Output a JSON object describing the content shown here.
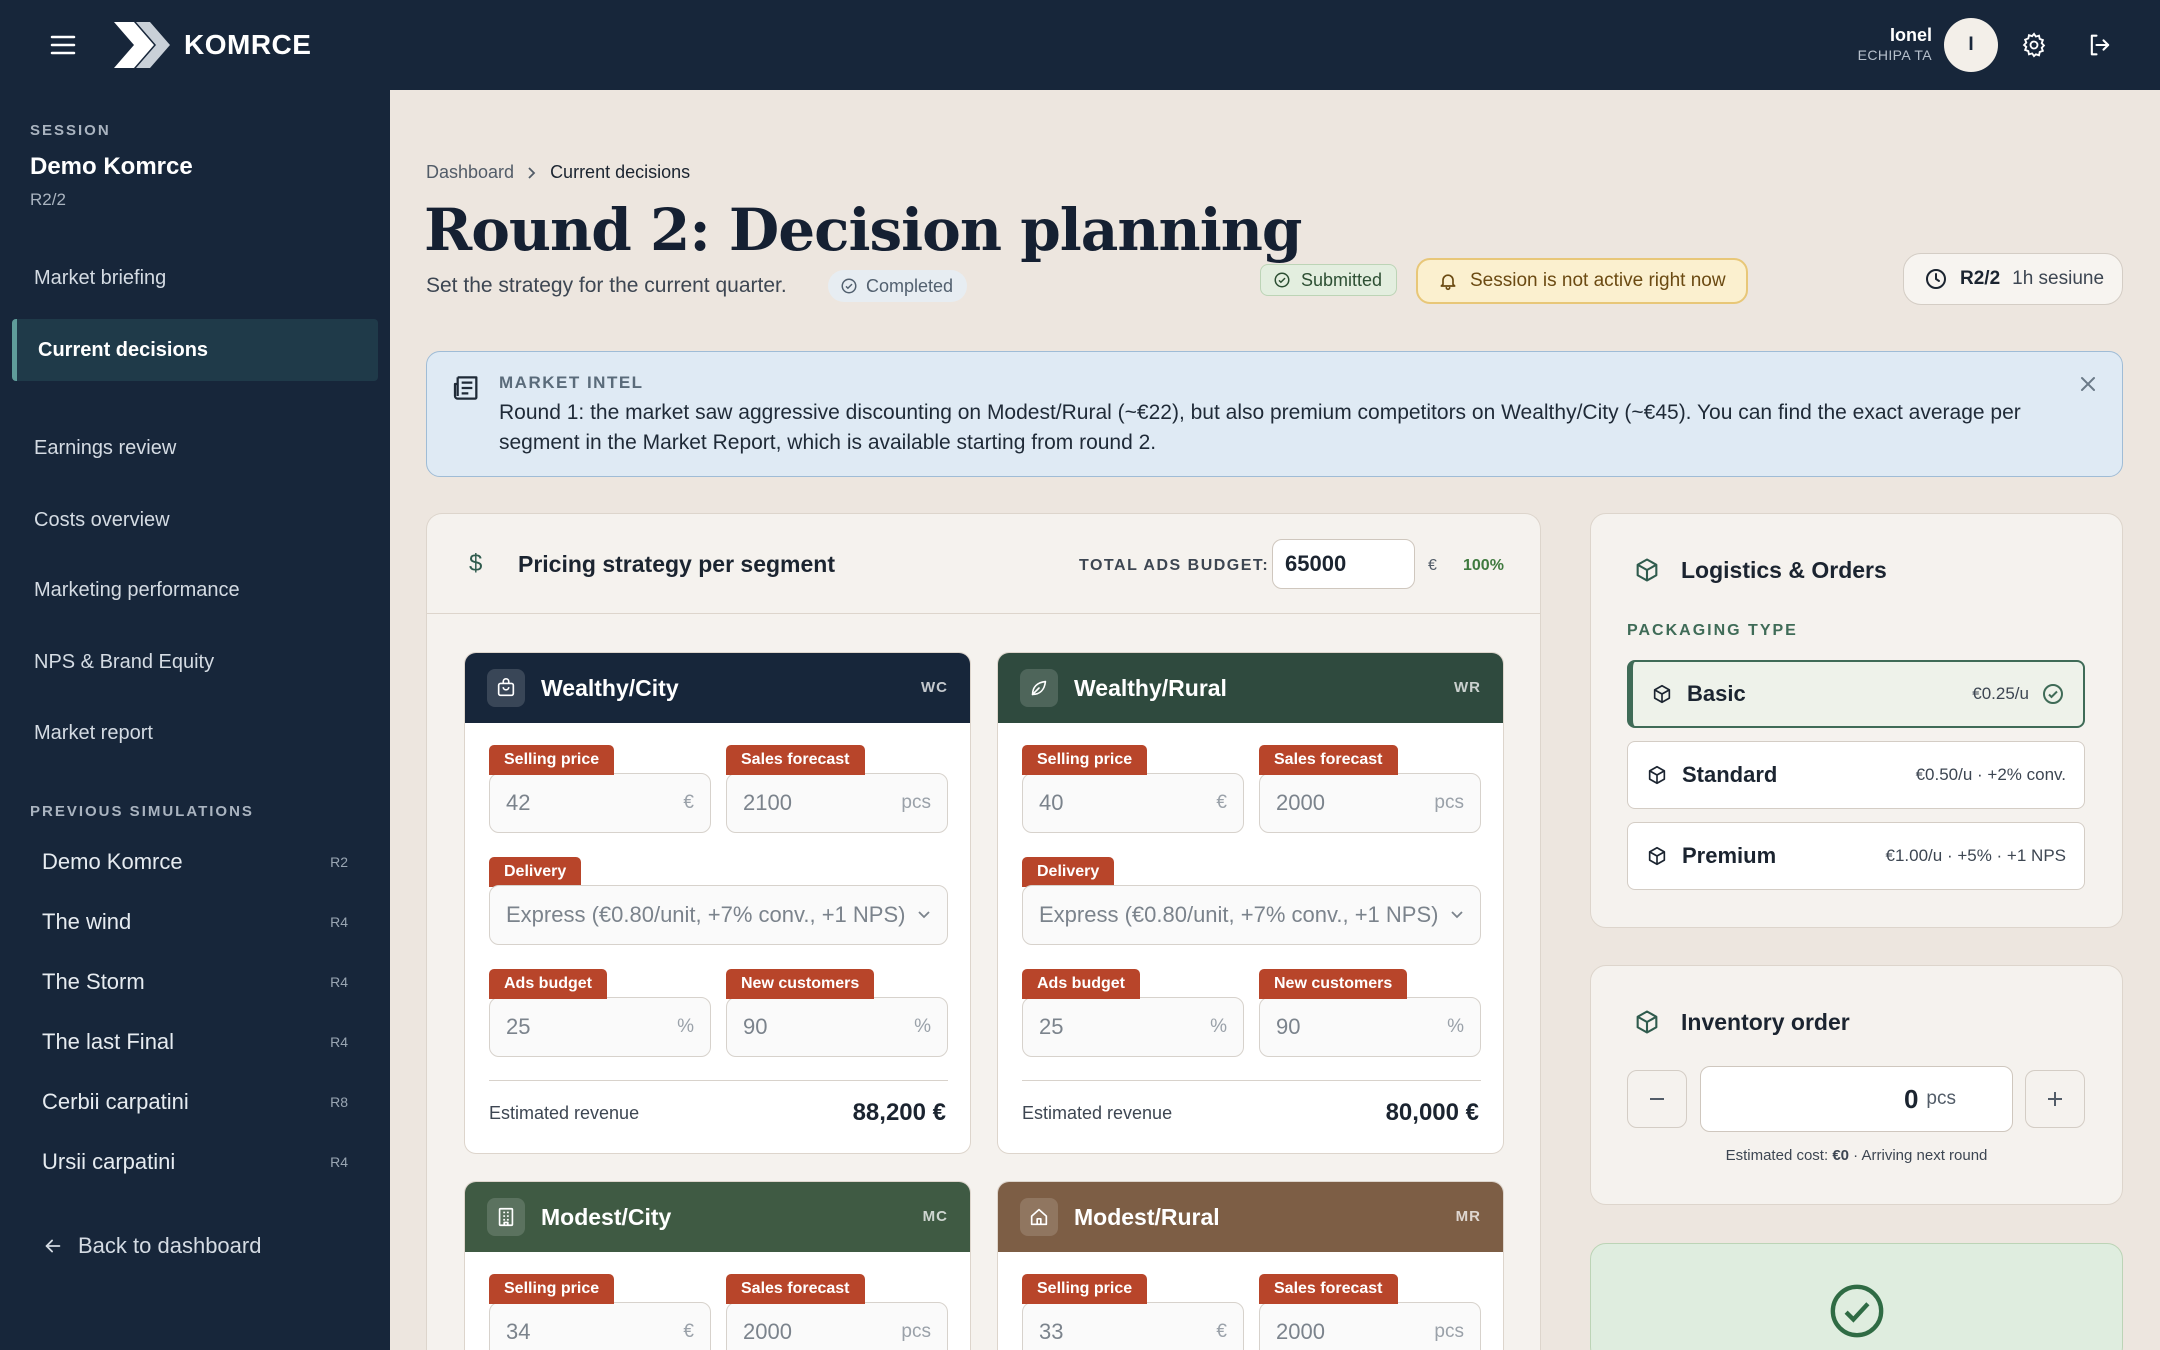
{
  "app": {
    "brand": "KOMRCE"
  },
  "user": {
    "name": "Ionel",
    "team": "ECHIPA TA",
    "initial": "I"
  },
  "sidebar": {
    "session_label": "SESSION",
    "session_name": "Demo Komrce",
    "session_round": "R2/2",
    "nav": [
      {
        "label": "Market briefing"
      },
      {
        "label": "Current decisions",
        "active": true
      },
      {
        "label": "Earnings review"
      },
      {
        "label": "Costs overview"
      },
      {
        "label": "Marketing performance"
      },
      {
        "label": "NPS & Brand Equity"
      },
      {
        "label": "Market report"
      }
    ],
    "previous_label": "PREVIOUS SIMULATIONS",
    "previous": [
      {
        "name": "Demo Komrce",
        "round": "R2"
      },
      {
        "name": "The wind",
        "round": "R4"
      },
      {
        "name": "The Storm",
        "round": "R4"
      },
      {
        "name": "The last Final",
        "round": "R4"
      },
      {
        "name": "Cerbii carpatini",
        "round": "R8"
      },
      {
        "name": "Ursii carpatini",
        "round": "R4"
      }
    ],
    "back_label": "Back to dashboard"
  },
  "breadcrumb": {
    "root": "Dashboard",
    "current": "Current decisions"
  },
  "header": {
    "title": "Round 2: Decision planning",
    "subtitle": "Set the strategy for the current quarter.",
    "completed": "Completed",
    "submitted": "Submitted",
    "session_status": "Session is not active right now",
    "round": "R2/2",
    "duration": "1h sesiune"
  },
  "intel": {
    "label": "MARKET INTEL",
    "text": "Round 1: the market saw aggressive discounting on Modest/Rural (~€22), but also premium competitors on Wealthy/City (~€45). You can find the exact average per segment in the Market Report, which is available starting from round 2."
  },
  "pricing": {
    "title": "Pricing strategy per segment",
    "ads_label": "TOTAL ADS BUDGET:",
    "ads_value": "65000",
    "ads_currency": "€",
    "ads_percent": "100%",
    "labels": {
      "selling_price": "Selling price",
      "sales_forecast": "Sales forecast",
      "delivery": "Delivery",
      "ads_budget": "Ads budget",
      "new_customers": "New customers",
      "estimated_revenue": "Estimated revenue",
      "euro": "€",
      "pcs": "pcs",
      "pct": "%"
    },
    "segments": [
      {
        "name": "Wealthy/City",
        "code": "WC",
        "color": "#17263a",
        "price": "42",
        "forecast": "2100",
        "delivery": "Express (€0.80/unit, +7% conv., +1 NPS)",
        "ads": "25",
        "new_customers": "90",
        "revenue": "88,200 €"
      },
      {
        "name": "Wealthy/Rural",
        "code": "WR",
        "color": "#2f4a3e",
        "price": "40",
        "forecast": "2000",
        "delivery": "Express (€0.80/unit, +7% conv., +1 NPS)",
        "ads": "25",
        "new_customers": "90",
        "revenue": "80,000 €"
      },
      {
        "name": "Modest/City",
        "code": "MC",
        "color": "#3f5a43",
        "price": "34",
        "forecast": "2000"
      },
      {
        "name": "Modest/Rural",
        "code": "MR",
        "color": "#7d5e45",
        "price": "33",
        "forecast": "2000"
      }
    ]
  },
  "logistics": {
    "title": "Logistics & Orders",
    "packaging_label": "PACKAGING TYPE",
    "options": [
      {
        "name": "Basic",
        "price": "€0.25/u",
        "selected": true
      },
      {
        "name": "Standard",
        "price": "€0.50/u · +2% conv."
      },
      {
        "name": "Premium",
        "price": "€1.00/u · +5% · +1 NPS"
      }
    ]
  },
  "inventory": {
    "title": "Inventory order",
    "value": "0",
    "unit": "pcs",
    "note_prefix": "Estimated cost: ",
    "note_cost": "€0",
    "note_suffix": " · Arriving next round"
  },
  "colors": {
    "navy": "#17263a",
    "accent_green": "#3f6b57",
    "label_red": "#b8452a",
    "page_bg": "#ede6df"
  }
}
